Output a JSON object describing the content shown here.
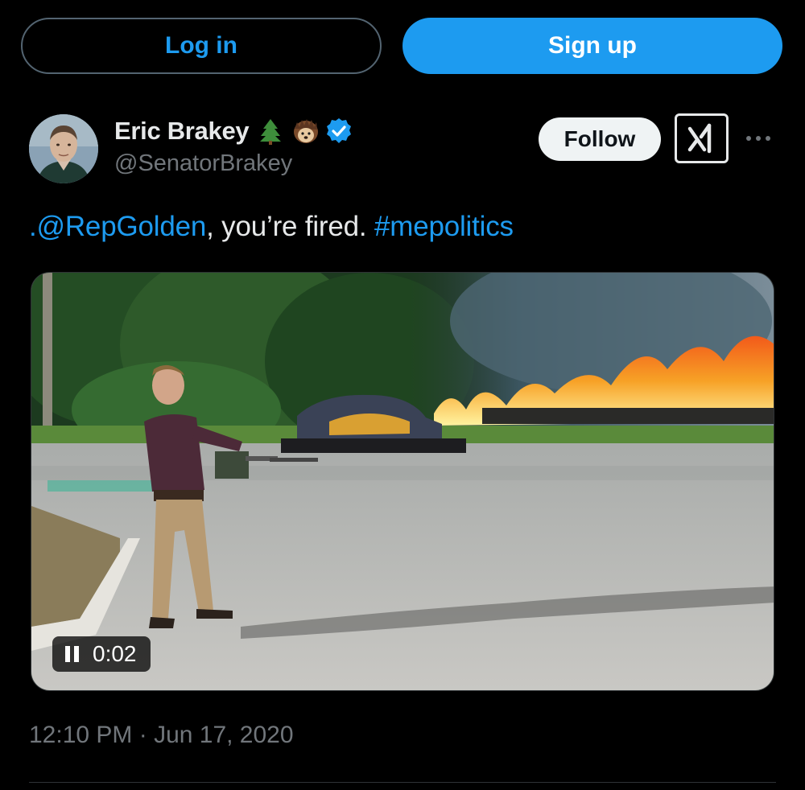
{
  "auth": {
    "login_label": "Log in",
    "signup_label": "Sign up"
  },
  "author": {
    "display_name": "Eric Brakey",
    "handle": "@SenatorBrakey",
    "emojis": [
      "evergreen-tree-icon",
      "hedgehog-icon"
    ],
    "verified": true
  },
  "actions": {
    "follow_label": "Follow",
    "grok_icon": "grok-icon",
    "more_icon": "more-icon"
  },
  "tweet": {
    "mention": ".@RepGolden",
    "text_middle": ", you’re fired. ",
    "hashtag": "#mepolitics"
  },
  "video": {
    "time": "0:02",
    "state": "playing"
  },
  "meta": {
    "timestamp": "12:10 PM · Jun 17, 2020"
  },
  "colors": {
    "accent": "#1d9bf0",
    "background": "#000000",
    "text": "#e7e9ea",
    "muted": "#71767b",
    "border": "#536471"
  }
}
